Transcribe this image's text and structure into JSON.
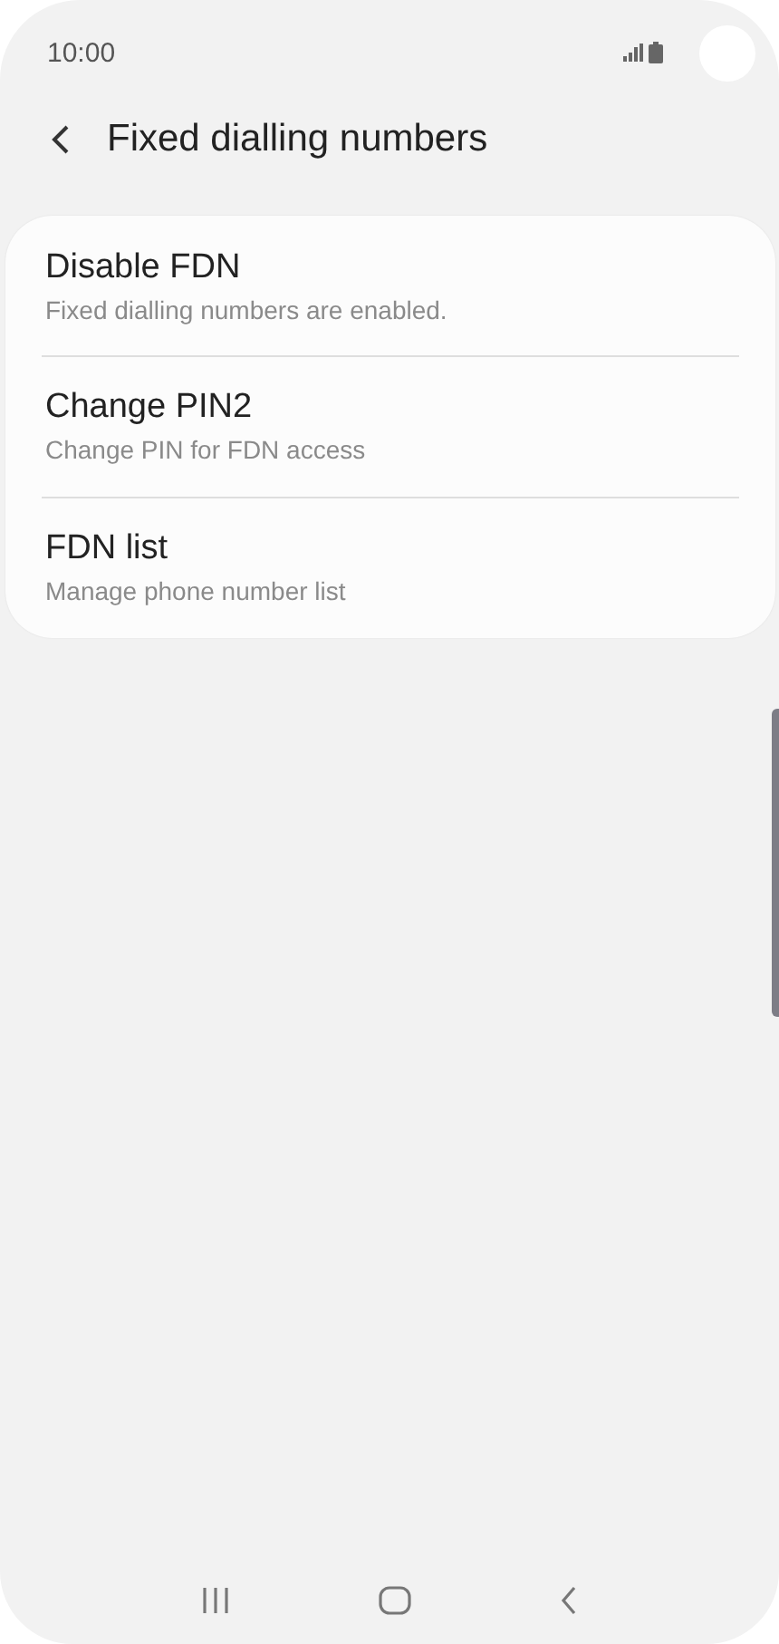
{
  "status_bar": {
    "time": "10:00"
  },
  "header": {
    "title": "Fixed dialling numbers"
  },
  "items": [
    {
      "title": "Disable FDN",
      "subtitle": "Fixed dialling numbers are enabled."
    },
    {
      "title": "Change PIN2",
      "subtitle": "Change PIN for FDN access"
    },
    {
      "title": "FDN list",
      "subtitle": "Manage phone number list"
    }
  ]
}
